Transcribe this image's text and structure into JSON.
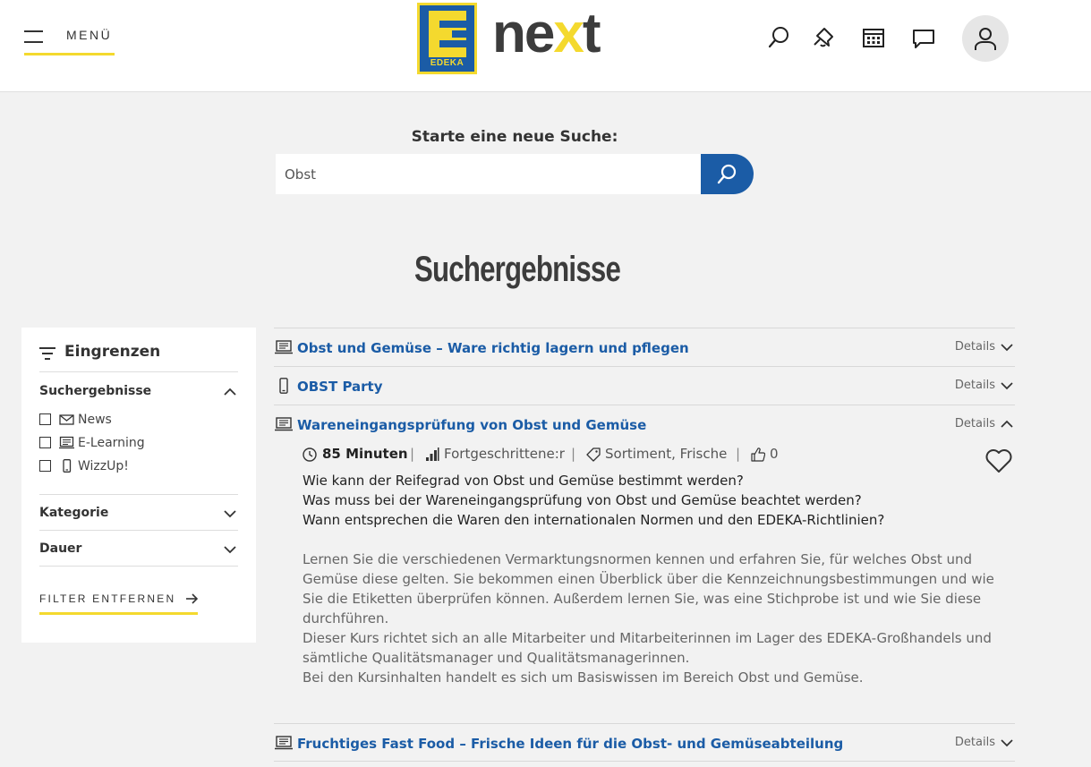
{
  "header": {
    "menu_label": "MENÜ",
    "logo_edeka": "EDEKA",
    "logo_ne": "ne",
    "logo_x": "x",
    "logo_t": "t",
    "brand_blue": "#1b5ca6",
    "brand_yellow": "#f4d92e"
  },
  "search": {
    "label": "Starte eine neue Suche:",
    "value": "Obst"
  },
  "results_title": "Suchergebnisse",
  "sidebar": {
    "title": "Eingrenzen",
    "section_results": "Suchergebnisse",
    "options": [
      {
        "label": "News",
        "icon": "mail-icon",
        "checked": false
      },
      {
        "label": "E-Learning",
        "icon": "elearning-icon",
        "checked": false
      },
      {
        "label": "WizzUp!",
        "icon": "phone-icon",
        "checked": false
      }
    ],
    "section_category": "Kategorie",
    "section_duration": "Dauer",
    "filter_remove": "FILTER ENTFERNEN"
  },
  "results": [
    {
      "title": "Obst und Gemüse – Ware richtig lagern und pflegen",
      "icon": "elearning-icon",
      "details": "Details",
      "expanded": false
    },
    {
      "title": "OBST Party",
      "icon": "phone-icon",
      "details": "Details",
      "expanded": false
    },
    {
      "title": "Wareneingangsprüfung von Obst und Gemüse",
      "icon": "elearning-icon",
      "details": "Details",
      "expanded": true
    },
    {
      "title": "Fruchtiges Fast Food – Frische Ideen für die Obst- und Gemüseabteilung",
      "icon": "elearning-icon",
      "details": "Details",
      "expanded": false
    }
  ],
  "expanded": {
    "duration": "85 Minuten",
    "level": "Fortgeschrittene:r",
    "tags": "Sortiment, Frische",
    "likes": "0",
    "questions": [
      "Wie kann der Reifegrad von Obst und Gemüse bestimmt werden?",
      "Was muss bei der Wareneingangsprüfung von Obst und Gemüse beachtet werden?",
      "Wann entsprechen die Waren den internationalen Normen und den EDEKA-Richtlinien?"
    ],
    "description": [
      "Lernen Sie die verschiedenen Vermarktungsnormen kennen und erfahren Sie, für welches Obst und",
      "Gemüse diese gelten. Sie bekommen einen Überblick über die Kennzeichnungsbestimmungen und wie",
      "Sie die Etiketten überprüfen können. Außerdem lernen Sie, was eine Stichprobe ist und wie Sie diese",
      "durchführen.",
      "Dieser Kurs richtet sich an alle Mitarbeiter und Mitarbeiterinnen im Lager des EDEKA-Großhandels und",
      "sämtliche Qualitätsmanager und Qualitätsmanagerinnen.",
      "Bei den Kursinhalten handelt es sich um Basiswissen im Bereich Obst und Gemüse."
    ]
  }
}
